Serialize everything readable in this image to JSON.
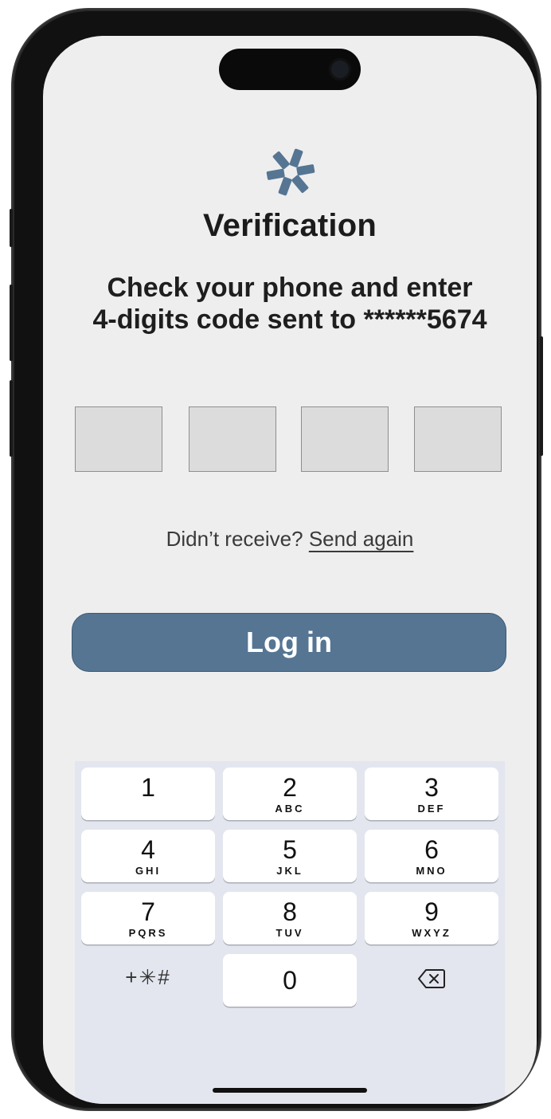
{
  "screen": {
    "title": "Verification",
    "instruction_line1": "Check your phone and enter",
    "instruction_line2": "4-digits code sent to ******5674"
  },
  "code_inputs": [
    "",
    "",
    "",
    ""
  ],
  "resend": {
    "prompt": "Didn’t receive?",
    "link": "Send again"
  },
  "login_button": "Log in",
  "keypad": {
    "keys": [
      {
        "num": "1",
        "letters": ""
      },
      {
        "num": "2",
        "letters": "ABC"
      },
      {
        "num": "3",
        "letters": "DEF"
      },
      {
        "num": "4",
        "letters": "GHI"
      },
      {
        "num": "5",
        "letters": "JKL"
      },
      {
        "num": "6",
        "letters": "MNO"
      },
      {
        "num": "7",
        "letters": "PQRS"
      },
      {
        "num": "8",
        "letters": "TUV"
      },
      {
        "num": "9",
        "letters": "WXYZ"
      }
    ],
    "symbols": "+✳#",
    "zero": "0",
    "delete_icon": "backspace-icon"
  },
  "colors": {
    "accent": "#557593",
    "background": "#efeeef",
    "keypad_bg": "#e3e6ee"
  }
}
